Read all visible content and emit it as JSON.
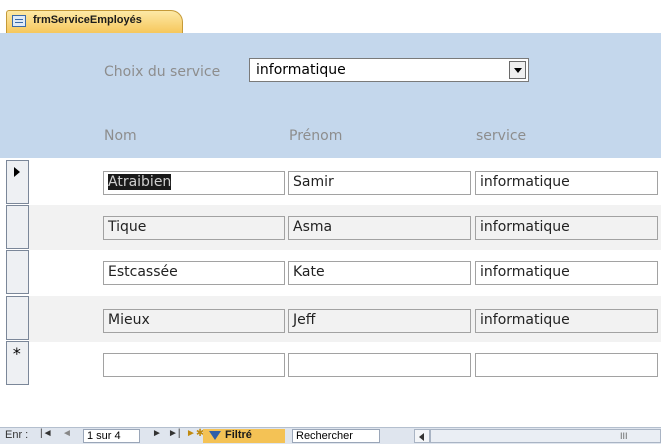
{
  "tab": {
    "title": "frmServiceEmployés"
  },
  "header": {
    "choice_label": "Choix du service",
    "choice_value": "informatique",
    "col_nom": "Nom",
    "col_prenom": "Prénom",
    "col_service": "service"
  },
  "records": [
    {
      "nom": "Atraibien",
      "prenom": "Samir",
      "service": "informatique"
    },
    {
      "nom": "Tique",
      "prenom": "Asma",
      "service": "informatique"
    },
    {
      "nom": "Estcassée",
      "prenom": "Kate",
      "service": "informatique"
    },
    {
      "nom": "Mieux",
      "prenom": "Jeff",
      "service": "informatique"
    }
  ],
  "new_record_marker": "*",
  "navbar": {
    "enr_label": "Enr :",
    "first": "|◄",
    "prev": "◄",
    "position": "1 sur 4",
    "next": "►",
    "last": "►|",
    "filter_label": "Filtré",
    "search_placeholder": "Rechercher",
    "scroll_grip": "III"
  },
  "colors": {
    "header_bg": "#c4d7ec",
    "tab_bg": "#f6c75c",
    "filter_bg": "#f4c255"
  }
}
